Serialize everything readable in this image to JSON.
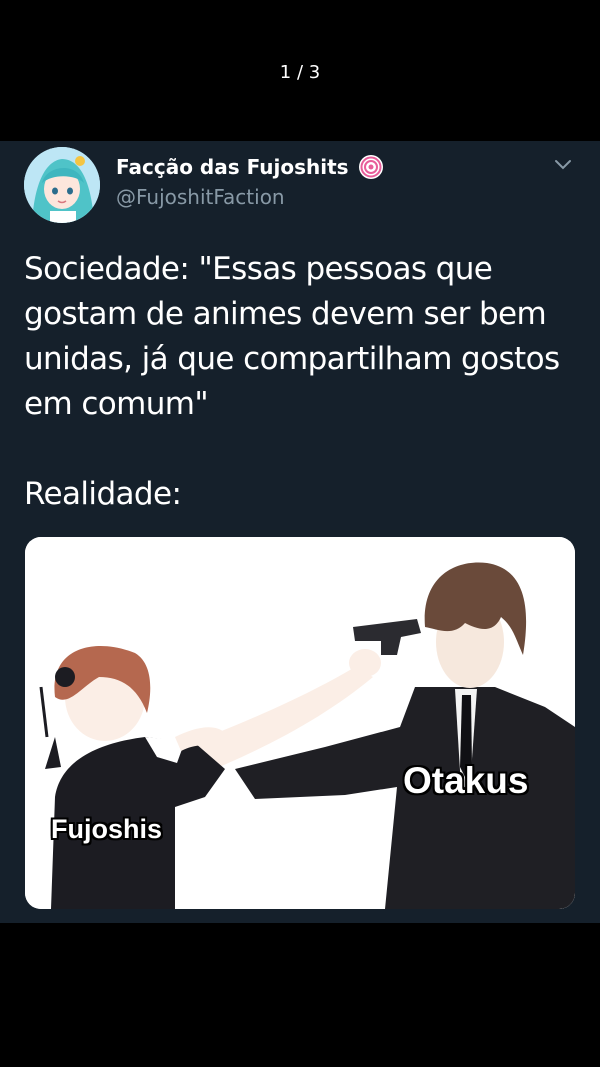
{
  "viewer": {
    "page_indicator": "1 / 3"
  },
  "tweet": {
    "author_name": "Facção das Fujoshits",
    "author_handle": "@FujoshitFaction",
    "text_line1": "Sociedade: \"Essas pessoas que gostam de animes devem ser bem unidas, já que compartilham gostos em comum\"",
    "text_line2": "Realidade:"
  },
  "media": {
    "label_right": "Otakus",
    "label_left": "Fujoshis"
  },
  "colors": {
    "background": "#000000",
    "tweet_bg": "#15202b",
    "text_primary": "#ffffff",
    "text_secondary": "#8899a6"
  },
  "icons": [
    "verified-badge-icon",
    "chevron-down-icon"
  ]
}
